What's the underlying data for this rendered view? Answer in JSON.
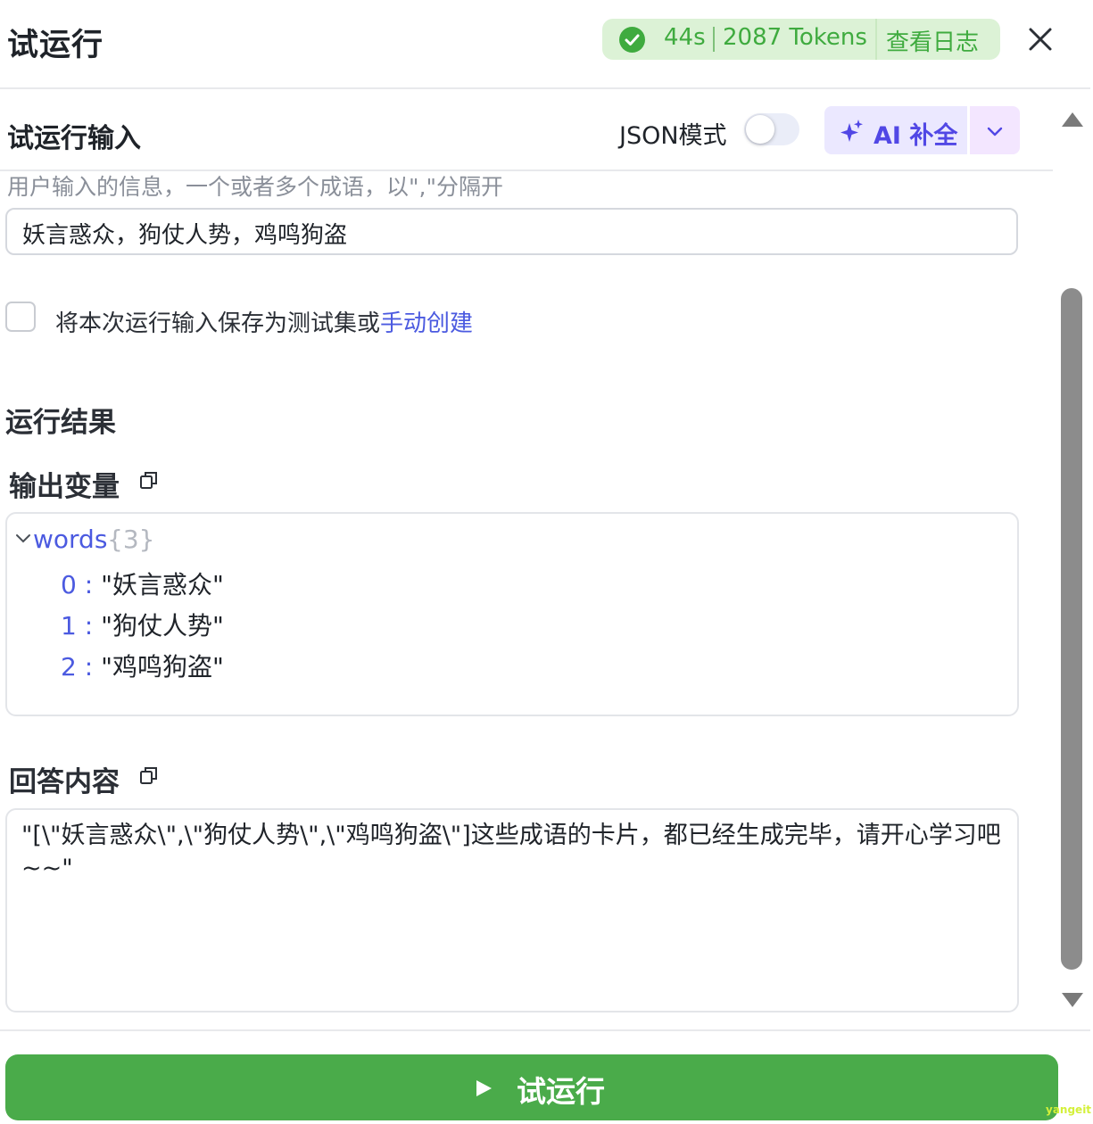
{
  "header": {
    "title": "试运行",
    "stats": {
      "time": "44s",
      "tokens": "2087 Tokens",
      "log_link": "查看日志"
    }
  },
  "input_section": {
    "title": "试运行输入",
    "json_mode_label": "JSON模式",
    "json_mode_on": false,
    "ai_button_label": "AI 补全",
    "field_label": "用户输入的信息，一个或者多个成语，以\",\"分隔开",
    "field_value": "妖言惑众，狗仗人势，鸡鸣狗盗",
    "save_text": "将本次运行输入保存为测试集或",
    "save_link": "手动创建"
  },
  "result": {
    "title": "运行结果",
    "output_title": "输出变量",
    "output_tree": {
      "key": "words",
      "count": "{3}",
      "items": [
        {
          "index": "0",
          "value": "\"妖言惑众\""
        },
        {
          "index": "1",
          "value": "\"狗仗人势\""
        },
        {
          "index": "2",
          "value": "\"鸡鸣狗盗\""
        }
      ]
    },
    "answer_title": "回答内容",
    "answer_text": "\"[\\\"妖言惑众\\\",\\\"狗仗人势\\\",\\\"鸡鸣狗盗\\\"]这些成语的卡片，都已经生成完毕，请开心学习吧~~\""
  },
  "footer": {
    "run_button_label": "试运行"
  },
  "watermark": "yangeit",
  "colors": {
    "accent": "#4b5ae0",
    "success": "#3fab3f",
    "run_button": "#4aab4a"
  }
}
